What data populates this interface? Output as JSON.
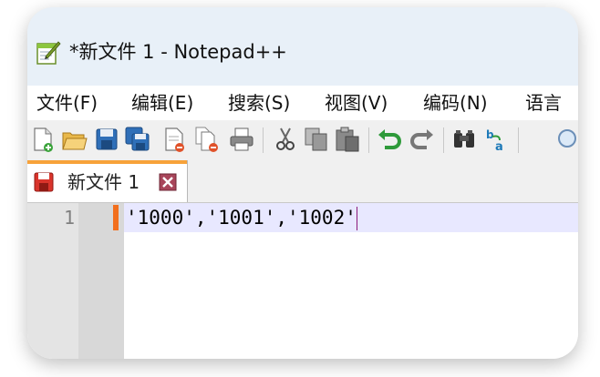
{
  "window": {
    "title": "*新文件 1 - Notepad++"
  },
  "menu": [
    {
      "label": "文件(F)"
    },
    {
      "label": "编辑(E)"
    },
    {
      "label": "搜索(S)"
    },
    {
      "label": "视图(V)"
    },
    {
      "label": "编码(N)"
    },
    {
      "label": "语言"
    }
  ],
  "toolbar": {
    "icons": [
      "new-file-icon",
      "open-file-icon",
      "save-icon",
      "save-all-icon",
      "close-icon",
      "close-all-icon",
      "print-icon",
      "cut-icon",
      "copy-icon",
      "paste-icon",
      "undo-icon",
      "redo-icon",
      "find-icon",
      "replace-icon",
      "zoom-icon"
    ]
  },
  "tabs": [
    {
      "label": "新文件 1",
      "modified": true
    }
  ],
  "editor": {
    "lines": [
      {
        "number": "1",
        "text": "'1000','1001','1002'"
      }
    ]
  },
  "colors": {
    "tab_accent": "#f7a23a",
    "change_marker": "#f26f1d",
    "current_line": "#e8e8ff"
  }
}
